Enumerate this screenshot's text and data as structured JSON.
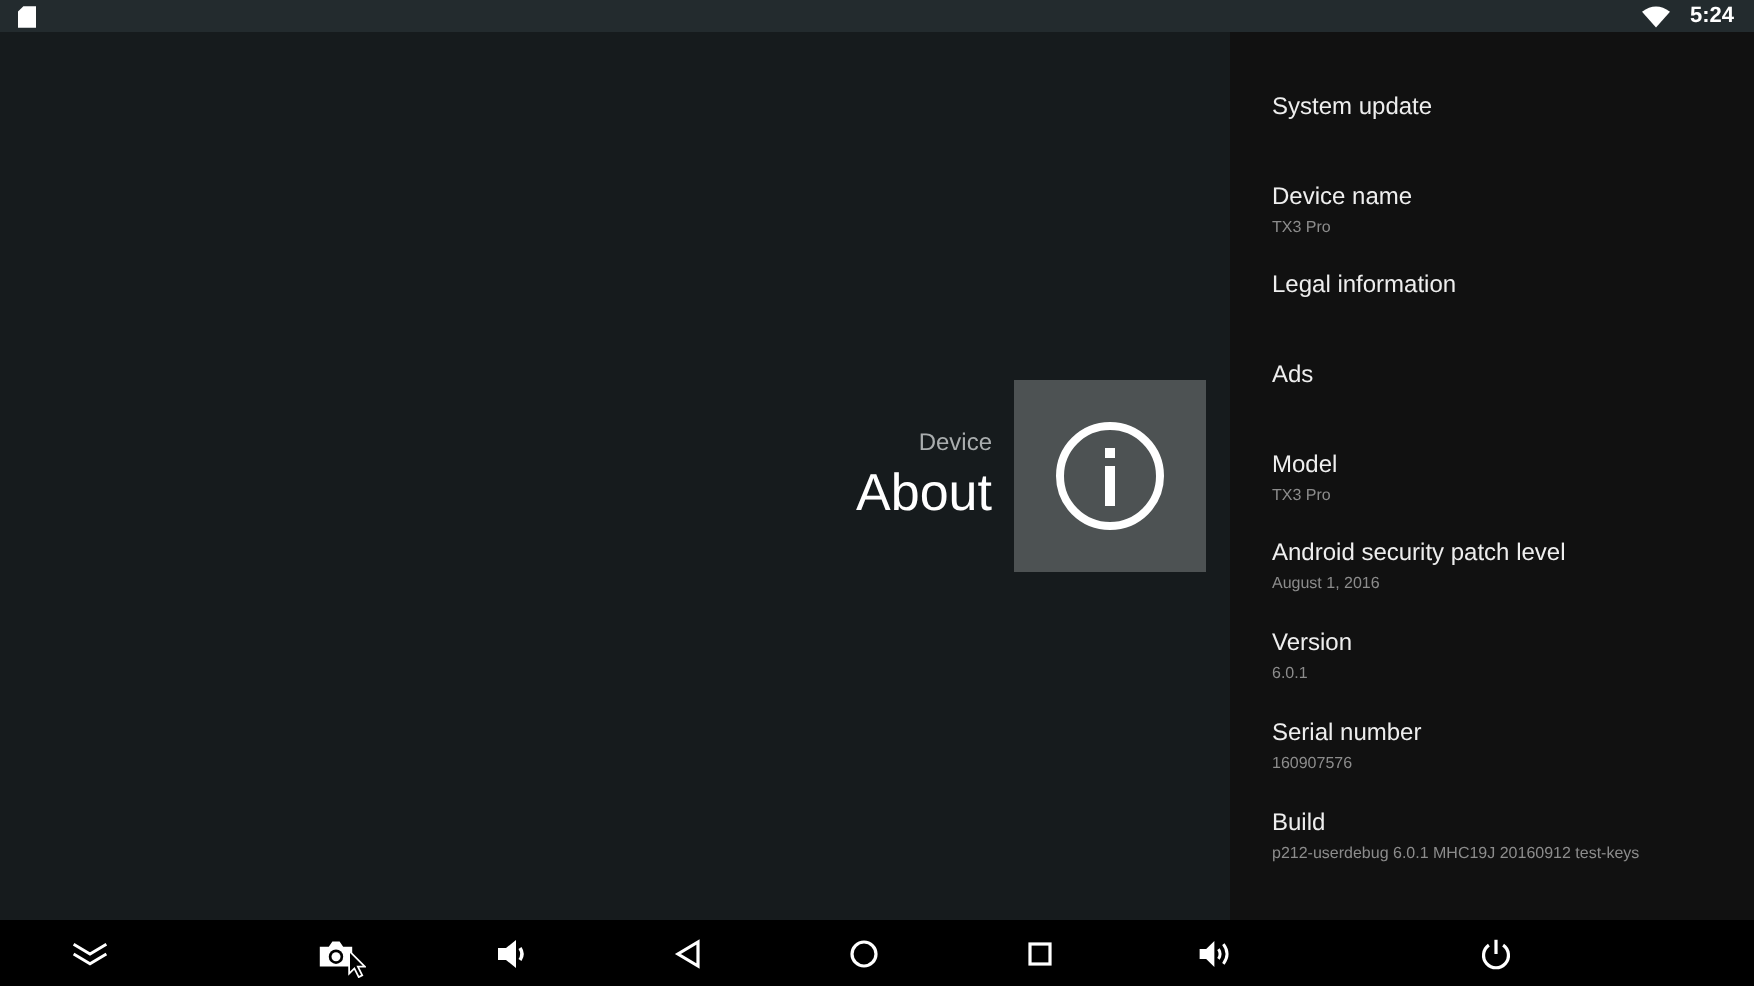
{
  "status_bar": {
    "time": "5:24"
  },
  "header": {
    "category": "Device",
    "title": "About"
  },
  "settings": [
    {
      "title": "System update"
    },
    {
      "title": "Device name",
      "summary": "TX3 Pro"
    },
    {
      "title": "Legal information"
    },
    {
      "title": "Ads"
    },
    {
      "title": "Model",
      "summary": "TX3 Pro"
    },
    {
      "title": "Android security patch level",
      "summary": "August 1, 2016"
    },
    {
      "title": "Version",
      "summary": "6.0.1"
    },
    {
      "title": "Serial number",
      "summary": "160907576"
    },
    {
      "title": "Build",
      "summary": "p212-userdebug 6.0.1 MHC19J 20160912 test-keys"
    }
  ],
  "nav_bar": [
    {
      "kind": "collapse"
    },
    {
      "kind": "screenshot"
    },
    {
      "kind": "volume-down"
    },
    {
      "kind": "back"
    },
    {
      "kind": "home"
    },
    {
      "kind": "recents"
    },
    {
      "kind": "volume-up"
    },
    {
      "kind": "power"
    }
  ]
}
